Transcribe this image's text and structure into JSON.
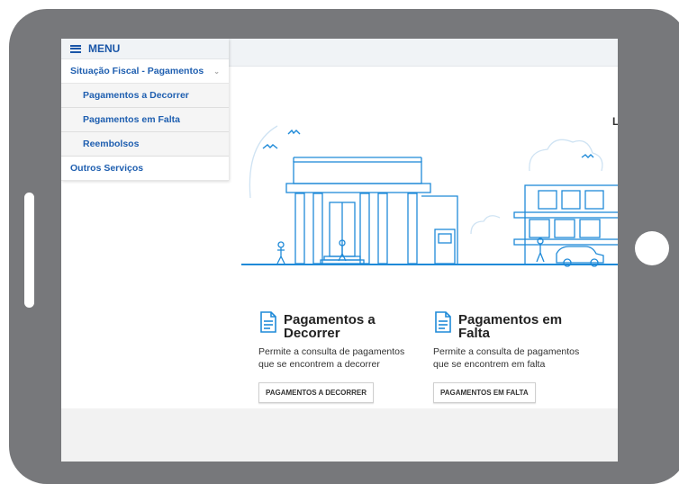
{
  "menu": {
    "title": "MENU",
    "items": [
      {
        "label": "Situação Fiscal - Pagamentos"
      },
      {
        "label": "Pagamentos a Decorrer"
      },
      {
        "label": "Pagamentos em Falta"
      },
      {
        "label": "Reembolsos"
      },
      {
        "label": "Outros Serviços"
      }
    ]
  },
  "header": {
    "corner_letter": "L"
  },
  "cards": [
    {
      "title": "Pagamentos a Decorrer",
      "description": "Permite a consulta de pagamentos que se encontrem a decorrer",
      "button_label": "PAGAMENTOS A DECORRER"
    },
    {
      "title": "Pagamentos em Falta",
      "description": "Permite a consulta de pagamentos que se encontrem em falta",
      "button_label": "PAGAMENTOS EM FALTA"
    }
  ],
  "colors": {
    "accent": "#1a56a8",
    "illustration": "#1f8ad8",
    "frame": "#77787b"
  },
  "icons": [
    "hamburger-icon",
    "chevron-down-icon",
    "document-icon"
  ]
}
